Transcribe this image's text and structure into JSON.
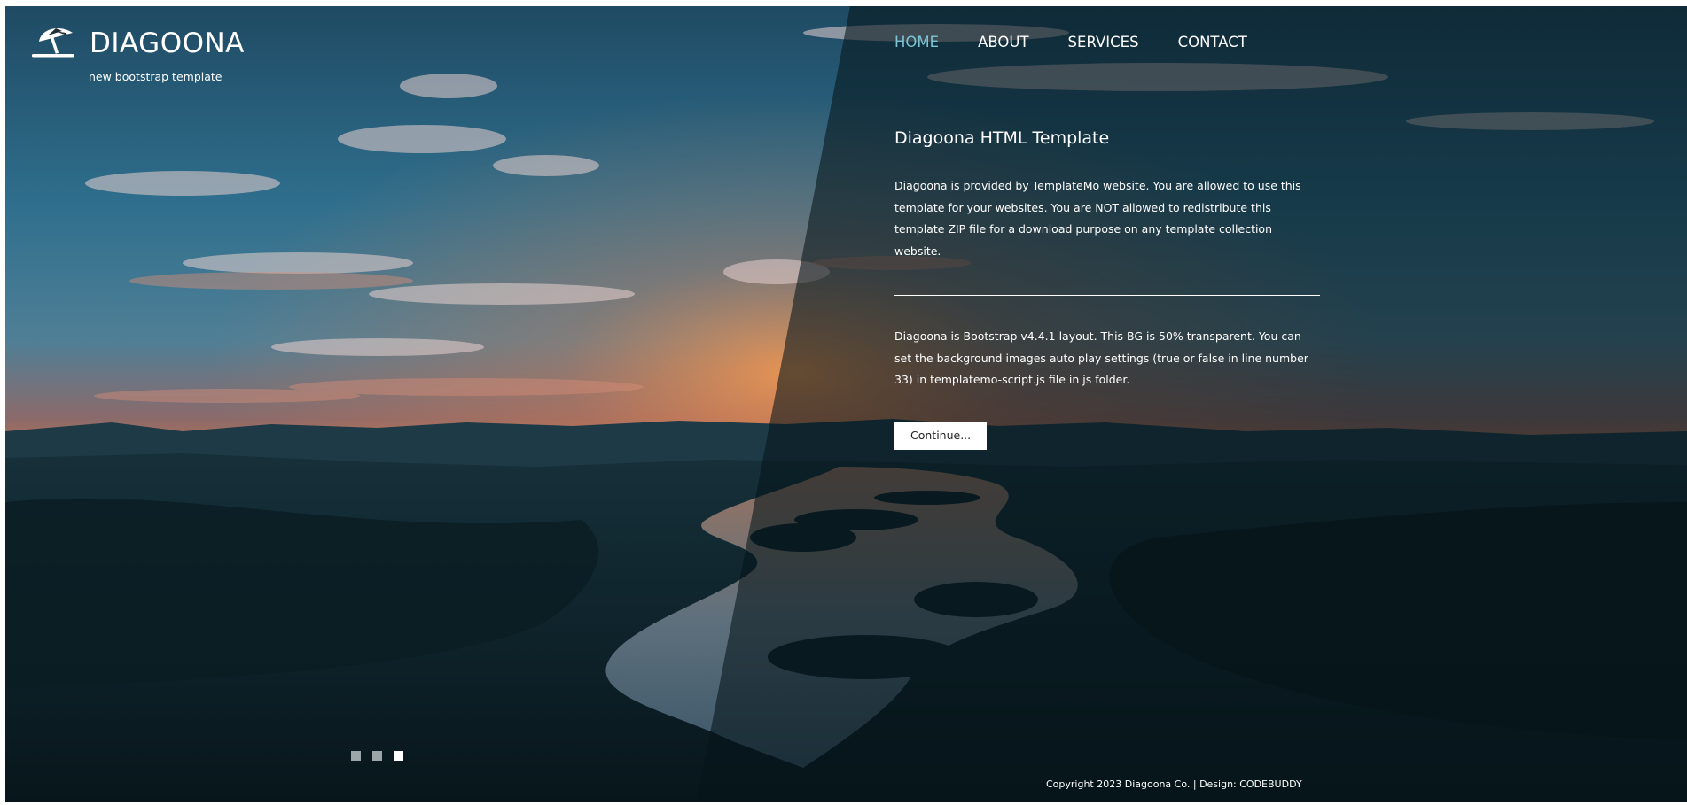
{
  "brand": {
    "name": "DIAGOONA",
    "tagline": "new bootstrap template",
    "icon": "beach-umbrella-icon"
  },
  "nav": {
    "items": [
      {
        "label": "HOME",
        "active": true
      },
      {
        "label": "ABOUT",
        "active": false
      },
      {
        "label": "SERVICES",
        "active": false
      },
      {
        "label": "CONTACT",
        "active": false
      }
    ]
  },
  "main": {
    "title": "Diagoona HTML Template",
    "paragraph1": "Diagoona is provided by TemplateMo website. You are allowed to use this template for your websites. You are NOT allowed to redistribute this template ZIP file for a download purpose on any template collection website.",
    "paragraph2": "Diagoona is Bootstrap v4.4.1 layout. This BG is 50% transparent. You can set the background images auto play settings (true or false in line number 33) in templatemo-script.js file in js folder.",
    "button_label": "Continue..."
  },
  "slider": {
    "dot_count": 3,
    "active_index": 2
  },
  "footer": {
    "text": "Copyright 2023 Diagoona Co. | Design: CODEBUDDY"
  },
  "colors": {
    "accent": "#7cc4d6",
    "overlay": "#05141a",
    "text": "#ffffff"
  }
}
